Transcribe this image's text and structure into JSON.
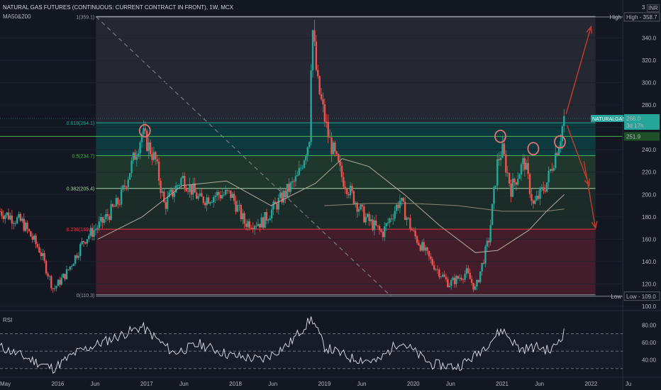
{
  "header": {
    "title": "NATURAL GAS FUTURES (CONTINUOUS: CURRENT CONTRACT IN FRONT), 1W, MCX",
    "indicator": "MA50&200",
    "currency": "INR",
    "scale_label": "3"
  },
  "rsi_label": "RSI",
  "price_tag": {
    "symbol": "NATURALGAS2021",
    "price": "268.0",
    "countdown": "3d 17h"
  },
  "marker_251": "251.9",
  "colors": {
    "background": "#131722",
    "up": "#26a69a",
    "down": "#ef5350",
    "ma": "#a8a29a",
    "fib_green": "#4caf50",
    "fib_red": "#f23645",
    "arrow": "#c0392b"
  },
  "chart_data": {
    "type": "candlestick",
    "timeframe": "1W",
    "ylim": [
      100,
      365
    ],
    "y_ticks": [
      100,
      120,
      140,
      160,
      180,
      200,
      220,
      240,
      260,
      280,
      300,
      320,
      340
    ],
    "x_ticks": [
      "May",
      "2016",
      "Jun",
      "2017",
      "Jun",
      "2018",
      "Jun",
      "2019",
      "Jun",
      "2020",
      "Jun",
      "2021",
      "Jun",
      "2022",
      "Ju"
    ],
    "high_low": [
      {
        "label": "High",
        "value": "358.7"
      },
      {
        "label": "Low",
        "value": "109.0"
      }
    ],
    "fib_levels": [
      {
        "label": "1(359.1)",
        "value": 359.1
      },
      {
        "label": "0.618(264.1)",
        "value": 264.1
      },
      {
        "label": "0.5(234.7)",
        "value": 234.7
      },
      {
        "label": "0.382(205.4)",
        "value": 205.4
      },
      {
        "label": "0.236(169.0)",
        "value": 169.0
      },
      {
        "label": "0(110.3)",
        "value": 110.3
      }
    ],
    "price_path_approx": [
      [
        2015.35,
        185
      ],
      [
        2015.6,
        175
      ],
      [
        2015.8,
        150
      ],
      [
        2015.95,
        115
      ],
      [
        2016.1,
        130
      ],
      [
        2016.3,
        160
      ],
      [
        2016.5,
        175
      ],
      [
        2016.7,
        195
      ],
      [
        2016.95,
        255
      ],
      [
        2017.1,
        230
      ],
      [
        2017.2,
        190
      ],
      [
        2017.4,
        215
      ],
      [
        2017.6,
        195
      ],
      [
        2017.8,
        200
      ],
      [
        2017.95,
        200
      ],
      [
        2018.1,
        175
      ],
      [
        2018.3,
        175
      ],
      [
        2018.55,
        200
      ],
      [
        2018.7,
        215
      ],
      [
        2018.83,
        250
      ],
      [
        2018.86,
        355
      ],
      [
        2018.92,
        300
      ],
      [
        2019.05,
        250
      ],
      [
        2019.2,
        215
      ],
      [
        2019.45,
        180
      ],
      [
        2019.65,
        165
      ],
      [
        2019.85,
        195
      ],
      [
        2020.0,
        165
      ],
      [
        2020.2,
        140
      ],
      [
        2020.4,
        120
      ],
      [
        2020.6,
        130
      ],
      [
        2020.7,
        115
      ],
      [
        2020.85,
        160
      ],
      [
        2020.95,
        230
      ],
      [
        2021.0,
        240
      ],
      [
        2021.1,
        205
      ],
      [
        2021.25,
        230
      ],
      [
        2021.35,
        190
      ],
      [
        2021.5,
        210
      ],
      [
        2021.65,
        250
      ],
      [
        2021.7,
        270
      ]
    ],
    "ma_lines": [
      {
        "name": "MA50",
        "points": [
          [
            2016.45,
            160
          ],
          [
            2016.95,
            180
          ],
          [
            2017.4,
            208
          ],
          [
            2017.9,
            212
          ],
          [
            2018.4,
            190
          ],
          [
            2018.9,
            210
          ],
          [
            2019.2,
            232
          ],
          [
            2019.5,
            225
          ],
          [
            2019.9,
            200
          ],
          [
            2020.3,
            172
          ],
          [
            2020.7,
            148
          ],
          [
            2020.95,
            150
          ],
          [
            2021.3,
            168
          ],
          [
            2021.5,
            185
          ],
          [
            2021.7,
            200
          ]
        ]
      },
      {
        "name": "MA200",
        "points": [
          [
            2019.0,
            190
          ],
          [
            2019.5,
            192
          ],
          [
            2020.0,
            192
          ],
          [
            2020.5,
            190
          ],
          [
            2021.0,
            185
          ],
          [
            2021.5,
            185
          ],
          [
            2021.7,
            187
          ]
        ]
      }
    ],
    "rsi": {
      "ylim": [
        20,
        95
      ],
      "levels": [
        70,
        50,
        30
      ],
      "y_ticks": [
        40,
        60,
        80
      ],
      "points": [
        [
          2015.35,
          55
        ],
        [
          2015.7,
          40
        ],
        [
          2015.95,
          30
        ],
        [
          2016.2,
          48
        ],
        [
          2016.5,
          60
        ],
        [
          2016.95,
          78
        ],
        [
          2017.3,
          48
        ],
        [
          2017.6,
          58
        ],
        [
          2017.95,
          45
        ],
        [
          2018.3,
          40
        ],
        [
          2018.6,
          58
        ],
        [
          2018.86,
          88
        ],
        [
          2019.0,
          55
        ],
        [
          2019.3,
          42
        ],
        [
          2019.6,
          38
        ],
        [
          2019.85,
          62
        ],
        [
          2020.2,
          35
        ],
        [
          2020.5,
          32
        ],
        [
          2020.7,
          45
        ],
        [
          2021.0,
          75
        ],
        [
          2021.2,
          52
        ],
        [
          2021.4,
          55
        ],
        [
          2021.55,
          50
        ],
        [
          2021.7,
          72
        ]
      ]
    }
  }
}
